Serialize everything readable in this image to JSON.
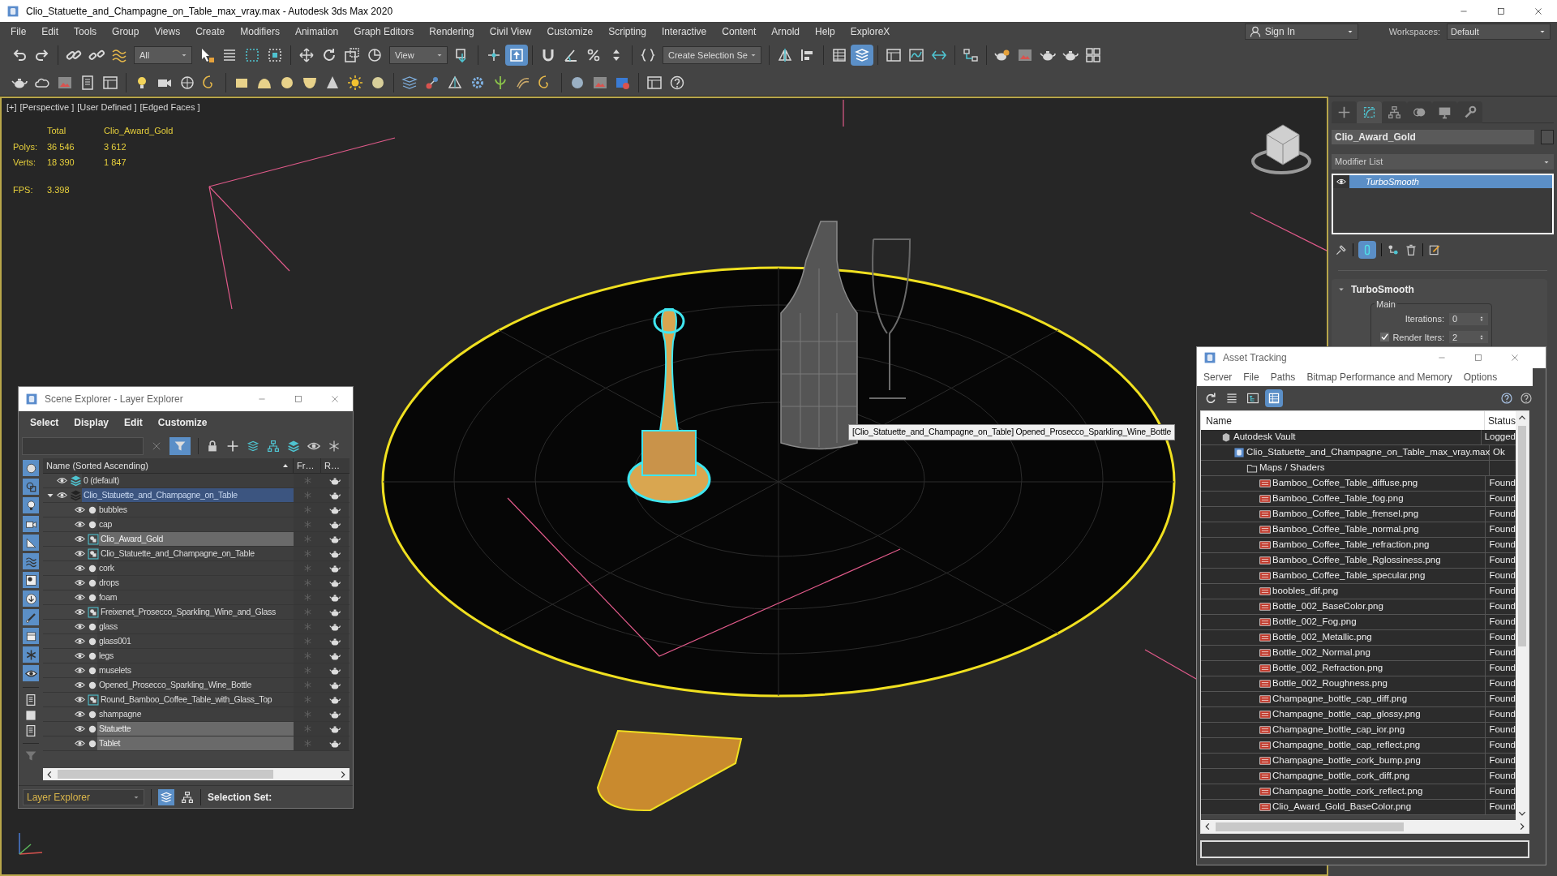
{
  "window": {
    "title": "Clio_Statuette_and_Champagne_on_Table_max_vray.max - Autodesk 3ds Max 2020"
  },
  "menu": [
    "File",
    "Edit",
    "Tools",
    "Group",
    "Views",
    "Create",
    "Modifiers",
    "Animation",
    "Graph Editors",
    "Rendering",
    "Civil View",
    "Customize",
    "Scripting",
    "Interactive",
    "Content",
    "Arnold",
    "Help",
    "ExploreX"
  ],
  "account": {
    "sign_in": "Sign In",
    "workspaces_label": "Workspaces:",
    "workspace": "Default"
  },
  "toolbar": {
    "row_1": [
      [
        {
          "kind": "undo",
          "on": false
        },
        {
          "kind": "redo",
          "on": false
        }
      ],
      [
        {
          "kind": "link",
          "on": false
        },
        {
          "kind": "unlink",
          "on": false
        },
        {
          "kind": "wave",
          "on": false
        },
        {
          "kind": "dropdown",
          "label": "All"
        },
        {
          "kind": "cursor",
          "on": false
        },
        {
          "kind": "list",
          "on": false
        },
        {
          "kind": "dashsq",
          "on": false
        },
        {
          "kind": "crossing",
          "on": false
        }
      ],
      [
        {
          "kind": "move",
          "on": false
        },
        {
          "kind": "rotate",
          "on": false
        },
        {
          "kind": "scale",
          "on": false
        },
        {
          "kind": "place",
          "on": false
        },
        {
          "kind": "dropdown",
          "label": "View"
        },
        {
          "kind": "pivot",
          "on": false
        }
      ],
      [
        {
          "kind": "manip",
          "on": false
        },
        {
          "kind": "arrowbox",
          "on": true
        }
      ],
      [
        {
          "kind": "magnet",
          "on": false
        },
        {
          "kind": "angle",
          "on": false
        },
        {
          "kind": "percent",
          "on": false
        },
        {
          "kind": "spinner",
          "on": false
        }
      ],
      [
        {
          "kind": "braces",
          "on": false
        },
        {
          "kind": "dropdown",
          "label": "Create Selection Se"
        }
      ],
      [
        {
          "kind": "mirror",
          "on": false
        },
        {
          "kind": "align",
          "on": false
        }
      ],
      [
        {
          "kind": "table",
          "on": false
        },
        {
          "kind": "layers",
          "on": true
        }
      ],
      [
        {
          "kind": "panel",
          "on": false
        },
        {
          "kind": "curve",
          "on": false
        },
        {
          "kind": "hline",
          "on": false
        }
      ],
      [
        {
          "kind": "schematic",
          "on": false
        }
      ],
      [
        {
          "kind": "teapotgear",
          "on": false
        },
        {
          "kind": "image",
          "on": false
        },
        {
          "kind": "teapot",
          "on": false
        },
        {
          "kind": "teapot",
          "on": false
        },
        {
          "kind": "grid4",
          "on": false
        }
      ]
    ],
    "row_2": [
      [
        {
          "kind": "teapot",
          "on": false
        },
        {
          "kind": "cloud",
          "on": false
        },
        {
          "kind": "image",
          "on": false
        },
        {
          "kind": "doc",
          "on": false
        },
        {
          "kind": "panel",
          "on": false
        }
      ],
      [
        {
          "kind": "bulb",
          "on": false
        },
        {
          "kind": "camera",
          "on": false
        },
        {
          "kind": "helper",
          "on": false
        },
        {
          "kind": "spiral",
          "on": false
        }
      ],
      [
        {
          "kind": "box",
          "on": false
        },
        {
          "kind": "dome",
          "on": false
        },
        {
          "kind": "sphere",
          "on": false
        },
        {
          "kind": "bowl",
          "on": false
        },
        {
          "kind": "cone",
          "on": false
        },
        {
          "kind": "sun",
          "on": false
        },
        {
          "kind": "disc",
          "on": false
        }
      ],
      [
        {
          "kind": "grid",
          "on": false
        },
        {
          "kind": "molecule",
          "on": false
        },
        {
          "kind": "pyramid",
          "on": false
        },
        {
          "kind": "gear",
          "on": false
        },
        {
          "kind": "plant",
          "on": false
        },
        {
          "kind": "hair",
          "on": false
        },
        {
          "kind": "spiral",
          "on": false
        }
      ],
      [
        {
          "kind": "ball",
          "on": false
        },
        {
          "kind": "image",
          "on": false
        },
        {
          "kind": "render",
          "on": false
        }
      ],
      [
        {
          "kind": "panel",
          "on": false
        },
        {
          "kind": "help",
          "on": false
        }
      ]
    ]
  },
  "viewport": {
    "labels": [
      "[+]",
      "[Perspective ]",
      "[User Defined ]",
      "[Edged Faces ]"
    ],
    "stats": {
      "headers": [
        "Total",
        "Clio_Award_Gold"
      ],
      "rows": [
        {
          "label": "Polys:",
          "total": "36 546",
          "selected": "3 612"
        },
        {
          "label": "Verts:",
          "total": "18 390",
          "selected": "1 847"
        }
      ],
      "fps_label": "FPS:",
      "fps": "3.398"
    },
    "tooltip": "[Clio_Statuette_and_Champagne_on_Table] Opened_Prosecco_Sparkling_Wine_Bottle"
  },
  "command_panel": {
    "tabs": [
      {
        "kind": "create",
        "selected": false
      },
      {
        "kind": "modify",
        "selected": true
      },
      {
        "kind": "hierarchy",
        "selected": false
      },
      {
        "kind": "motion",
        "selected": false
      },
      {
        "kind": "display",
        "selected": false
      },
      {
        "kind": "utilities",
        "selected": false
      }
    ],
    "object_name": "Clio_Award_Gold",
    "modifier_list": "Modifier List",
    "stack": [
      {
        "label": "TurboSmooth",
        "selected": true
      }
    ],
    "rollout": {
      "title": "TurboSmooth",
      "group": "Main",
      "fields": [
        {
          "kind": "spinner",
          "label": "Iterations:",
          "value": "0"
        },
        {
          "kind": "checkbox_spinner",
          "label": "Render Iters:",
          "value": "2",
          "checked": true
        }
      ]
    }
  },
  "scene_explorer": {
    "title": "Scene Explorer - Layer Explorer",
    "menu": [
      "Select",
      "Display",
      "Edit",
      "Customize"
    ],
    "filter_active": true,
    "filters": [
      {
        "kind": "geometry",
        "on": true
      },
      {
        "kind": "shapes",
        "on": true
      },
      {
        "kind": "lights",
        "on": true
      },
      {
        "kind": "cameras",
        "on": true
      },
      {
        "kind": "helpers",
        "on": true
      },
      {
        "kind": "spacewarps",
        "on": true
      },
      {
        "kind": "groups",
        "on": true
      },
      {
        "kind": "xrefs",
        "on": true
      },
      {
        "kind": "bones",
        "on": true
      },
      {
        "kind": "containers",
        "on": true
      },
      {
        "kind": "frozen",
        "on": true
      },
      {
        "kind": "hidden",
        "on": true
      }
    ],
    "columns": [
      "Name (Sorted Ascending)",
      "Fr…",
      "R…"
    ],
    "rows": [
      {
        "kind": "layer",
        "label": "0 (default)",
        "current": true,
        "selected": false
      },
      {
        "kind": "layer",
        "label": "Clio_Statuette_and_Champagne_on_Table",
        "current": false,
        "selected": true,
        "expanded": true,
        "children": [
          {
            "kind": "object",
            "label": "bubbles",
            "selected": false
          },
          {
            "kind": "object",
            "label": "cap",
            "selected": false
          },
          {
            "kind": "group",
            "label": "Clio_Award_Gold",
            "selected": true
          },
          {
            "kind": "group",
            "label": "Clio_Statuette_and_Champagne_on_Table",
            "selected": false
          },
          {
            "kind": "object",
            "label": "cork",
            "selected": false
          },
          {
            "kind": "object",
            "label": "drops",
            "selected": false
          },
          {
            "kind": "object",
            "label": "foam",
            "selected": false
          },
          {
            "kind": "group",
            "label": "Freixenet_Prosecco_Sparkling_Wine_and_Glass",
            "selected": false
          },
          {
            "kind": "object",
            "label": "glass",
            "selected": false
          },
          {
            "kind": "object",
            "label": "glass001",
            "selected": false
          },
          {
            "kind": "object",
            "label": "legs",
            "selected": false
          },
          {
            "kind": "object",
            "label": "muselets",
            "selected": false
          },
          {
            "kind": "object",
            "label": "Opened_Prosecco_Sparkling_Wine_Bottle",
            "selected": false
          },
          {
            "kind": "group",
            "label": "Round_Bamboo_Coffee_Table_with_Glass_Top",
            "selected": false
          },
          {
            "kind": "object",
            "label": "shampagne",
            "selected": false
          },
          {
            "kind": "object",
            "label": "Statuette",
            "selected": true
          },
          {
            "kind": "object",
            "label": "Tablet",
            "selected": true
          }
        ]
      }
    ],
    "footer": {
      "explorer": "Layer Explorer",
      "selection_set": "Selection Set:"
    }
  },
  "asset_tracking": {
    "title": "Asset Tracking",
    "menu": [
      "Server",
      "File",
      "Paths",
      "Bitmap Performance and Memory",
      "Options"
    ],
    "toolbar": [
      {
        "kind": "refresh",
        "selected": false
      },
      {
        "kind": "list",
        "selected": false
      },
      {
        "kind": "tree",
        "selected": false
      },
      {
        "kind": "table",
        "selected": true
      }
    ],
    "columns": [
      "Name",
      "Status"
    ],
    "rows": [
      {
        "kind": "vault",
        "name": "Autodesk Vault",
        "status": "Logged",
        "children": [
          {
            "kind": "maxfile",
            "name": "Clio_Statuette_and_Champagne_on_Table_max_vray.max",
            "status": "Ok",
            "children": [
              {
                "kind": "folder",
                "name": "Maps / Shaders",
                "children": [
                  {
                    "kind": "png",
                    "name": "Bamboo_Coffee_Table_diffuse.png",
                    "status": "Found"
                  },
                  {
                    "kind": "png",
                    "name": "Bamboo_Coffee_Table_fog.png",
                    "status": "Found"
                  },
                  {
                    "kind": "png",
                    "name": "Bamboo_Coffee_Table_frensel.png",
                    "status": "Found"
                  },
                  {
                    "kind": "png",
                    "name": "Bamboo_Coffee_Table_normal.png",
                    "status": "Found"
                  },
                  {
                    "kind": "png",
                    "name": "Bamboo_Coffee_Table_refraction.png",
                    "status": "Found"
                  },
                  {
                    "kind": "png",
                    "name": "Bamboo_Coffee_Table_Rglossiness.png",
                    "status": "Found"
                  },
                  {
                    "kind": "png",
                    "name": "Bamboo_Coffee_Table_specular.png",
                    "status": "Found"
                  },
                  {
                    "kind": "png",
                    "name": "boobles_dif.png",
                    "status": "Found"
                  },
                  {
                    "kind": "png",
                    "name": "Bottle_002_BaseColor.png",
                    "status": "Found"
                  },
                  {
                    "kind": "png",
                    "name": "Bottle_002_Fog.png",
                    "status": "Found"
                  },
                  {
                    "kind": "png",
                    "name": "Bottle_002_Metallic.png",
                    "status": "Found"
                  },
                  {
                    "kind": "png",
                    "name": "Bottle_002_Normal.png",
                    "status": "Found"
                  },
                  {
                    "kind": "png",
                    "name": "Bottle_002_Refraction.png",
                    "status": "Found"
                  },
                  {
                    "kind": "png",
                    "name": "Bottle_002_Roughness.png",
                    "status": "Found"
                  },
                  {
                    "kind": "png",
                    "name": "Champagne_bottle_cap_diff.png",
                    "status": "Found"
                  },
                  {
                    "kind": "png",
                    "name": "Champagne_bottle_cap_glossy.png",
                    "status": "Found"
                  },
                  {
                    "kind": "png",
                    "name": "Champagne_bottle_cap_ior.png",
                    "status": "Found"
                  },
                  {
                    "kind": "png",
                    "name": "Champagne_bottle_cap_reflect.png",
                    "status": "Found"
                  },
                  {
                    "kind": "png",
                    "name": "Champagne_bottle_cork_bump.png",
                    "status": "Found"
                  },
                  {
                    "kind": "png",
                    "name": "Champagne_bottle_cork_diff.png",
                    "status": "Found"
                  },
                  {
                    "kind": "png",
                    "name": "Champagne_bottle_cork_reflect.png",
                    "status": "Found"
                  },
                  {
                    "kind": "png",
                    "name": "Clio_Award_Gold_BaseColor.png",
                    "status": "Found"
                  }
                ]
              }
            ]
          }
        ]
      }
    ]
  }
}
